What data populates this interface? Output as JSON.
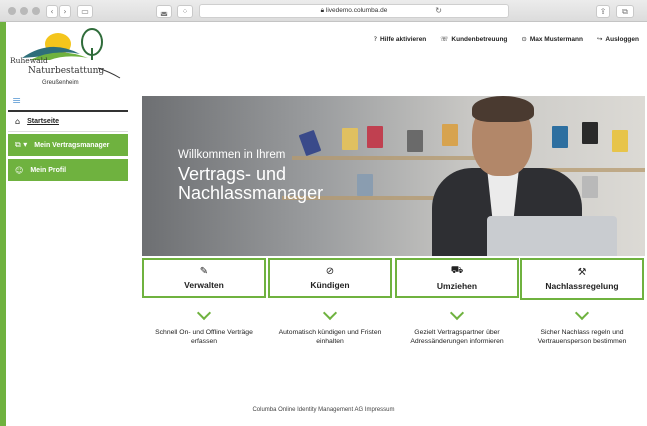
{
  "browser": {
    "url": "livedemo.columba.de",
    "back_glyph": "‹",
    "forward_glyph": "›"
  },
  "logo": {
    "line1": "Ruhewald",
    "line2": "Naturbestattung",
    "line3": "Greußenheim"
  },
  "topnav": [
    {
      "icon": "?",
      "label": "Hilfe aktivieren"
    },
    {
      "icon": "☏",
      "label": "Kundenbetreuung"
    },
    {
      "icon": "⊙",
      "label": "Max Mustermann"
    },
    {
      "icon": "↪",
      "label": "Ausloggen"
    }
  ],
  "sidebar": {
    "items": [
      {
        "icon": "⌂",
        "label": "Startseite"
      },
      {
        "icon": "⧉ ▾",
        "label": "Mein Vertragsmanager"
      },
      {
        "icon": "☺",
        "label": "Mein Profil"
      }
    ]
  },
  "hero": {
    "small": "Willkommen in Ihrem",
    "big": "Vertrags- und Nachlassmanager"
  },
  "cards": [
    {
      "icon": "✎",
      "label": "Verwalten",
      "desc": "Schnell On- und Offline Verträge erfassen"
    },
    {
      "icon": "⊘",
      "label": "Kündigen",
      "desc": "Automatisch kündigen und Fristen einhalten"
    },
    {
      "icon": "⛟",
      "label": "Umziehen",
      "desc": "Gezielt Vertragspartner über Adressänderungen informieren"
    },
    {
      "icon": "⚒",
      "label": "Nachlassregelung",
      "desc": "Sicher Nachlass regeln und Vertrauensperson bestimmen"
    }
  ],
  "footer": "Columba Online Identity Management AG Impressum",
  "colors": {
    "accent": "#6fb23f",
    "link": "#6aa3d8"
  }
}
